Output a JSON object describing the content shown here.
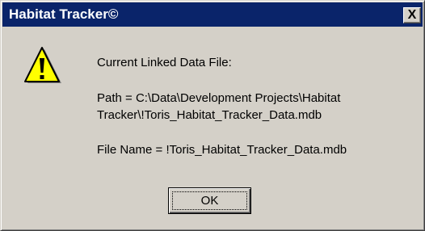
{
  "window": {
    "title": "Habitat Tracker©",
    "close_label": "X",
    "title_bar_color": "#0a246a",
    "face_color": "#d4d0c8"
  },
  "icon": {
    "name": "warning-icon",
    "color": "#ffff00"
  },
  "message": {
    "header": "Current Linked Data File:",
    "path_line1": "Path =  C:\\Data\\Development Projects\\Habitat",
    "path_line2": "Tracker\\!Toris_Habitat_Tracker_Data.mdb",
    "file_name": "File Name = !Toris_Habitat_Tracker_Data.mdb"
  },
  "buttons": {
    "ok_label": "OK"
  }
}
